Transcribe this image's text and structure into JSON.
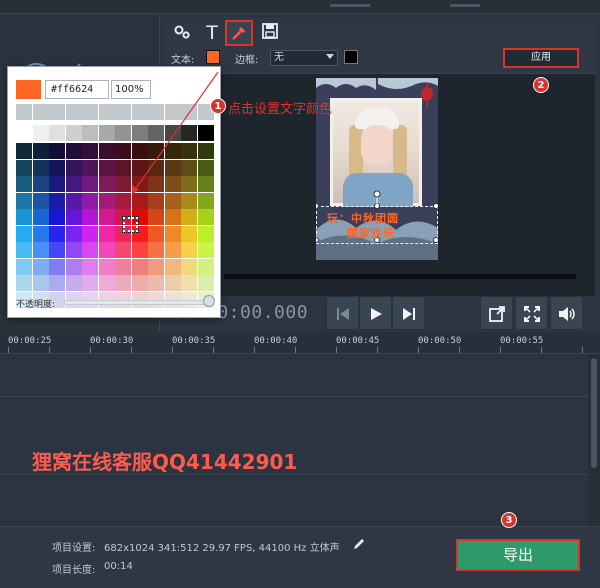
{
  "toolbar": {
    "settings_icon": "gear-icon",
    "text_tool_icon": "text-t-icon",
    "eyedropper_icon": "eyedropper-icon",
    "save_icon": "save-icon",
    "text_label": "文本:",
    "text_color": "#ff6624",
    "border_label": "边框:",
    "border_value": "无",
    "border_color": "#000000",
    "apply_label": "应用"
  },
  "color_picker": {
    "current_color": "#ff6624",
    "hex_value": "#ff6624",
    "opacity_value": "100%",
    "opacity_label": "不透明度:",
    "opacity_level": 1.0
  },
  "callouts": {
    "step1_number": "1",
    "step1_text": "点击设置文字颜色",
    "step2_number": "2",
    "step3_number": "3"
  },
  "poster": {
    "line1": "玩：中秋团圆",
    "line2": "国家欢乐"
  },
  "player": {
    "timecode": "00:00:00.000",
    "buttons": {
      "prev": "⏮",
      "play": "▶",
      "next": "⏭",
      "popout": "⧉",
      "fullscreen": "⛶",
      "volume": "🔊"
    }
  },
  "timeline": {
    "ticks": [
      "00:00:25",
      "00:00:30",
      "00:00:35",
      "00:00:40",
      "00:00:45",
      "00:00:50",
      "00:00:55"
    ]
  },
  "watermark": "狸窝在线客服QQ41442901",
  "footer": {
    "project_settings_label": "项目设置:",
    "project_settings_value": "682x1024 341:512 29.97 FPS, 44100 Hz 立体声",
    "edit_icon": "pencil-icon",
    "project_length_label": "项目长度:",
    "project_length_value": "00:14",
    "export_label": "导出"
  },
  "colors": {
    "accent_red": "#d9342b",
    "export_green": "#2f9a6a",
    "text_orange": "#ff6624"
  }
}
